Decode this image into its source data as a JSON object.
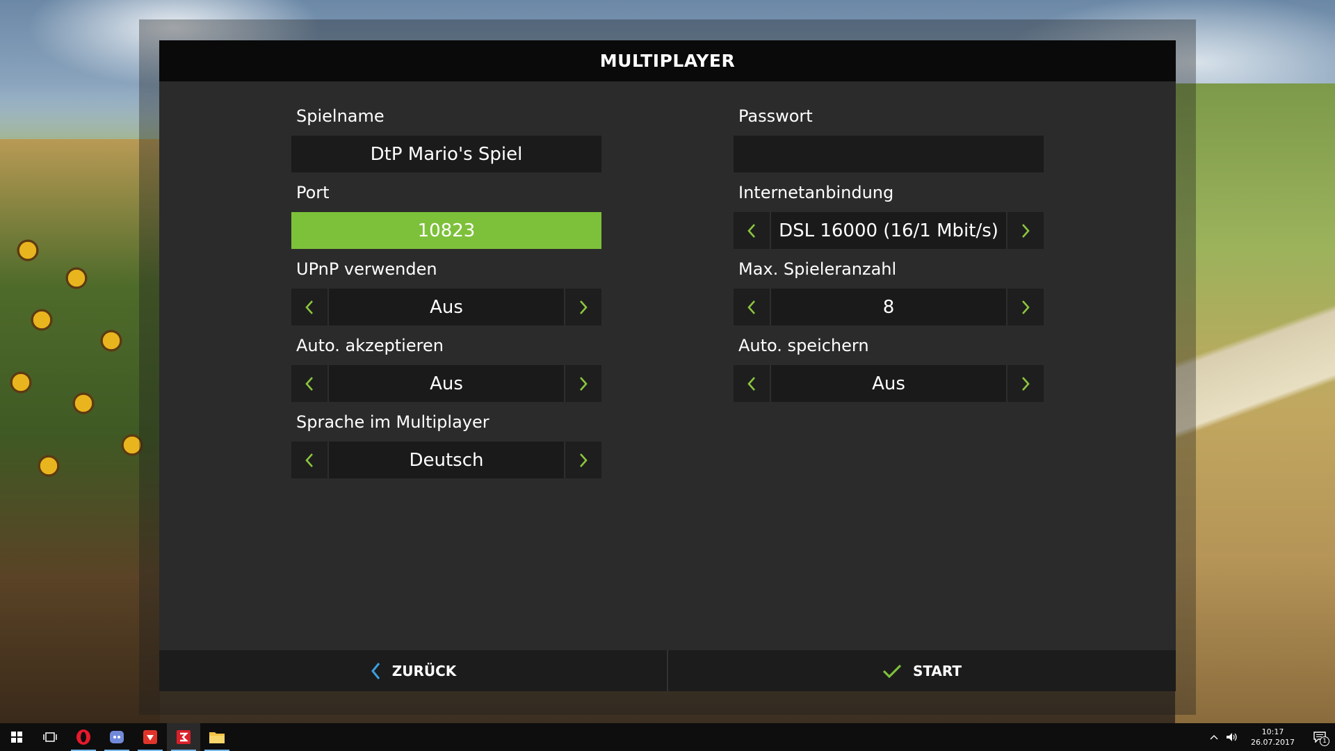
{
  "dialog": {
    "title": "MULTIPLAYER"
  },
  "fields": {
    "game_name": {
      "label": "Spielname",
      "value": "DtP Mario's Spiel"
    },
    "password": {
      "label": "Passwort",
      "value": ""
    },
    "port": {
      "label": "Port",
      "value": "10823"
    },
    "internet": {
      "label": "Internetanbindung",
      "value": "DSL 16000 (16/1 Mbit/s)"
    },
    "upnp": {
      "label": "UPnP verwenden",
      "value": "Aus"
    },
    "max_players": {
      "label": "Max. Spieleranzahl",
      "value": "8"
    },
    "auto_accept": {
      "label": "Auto. akzeptieren",
      "value": "Aus"
    },
    "auto_save": {
      "label": "Auto. speichern",
      "value": "Aus"
    },
    "language": {
      "label": "Sprache im Multiplayer",
      "value": "Deutsch"
    }
  },
  "footer": {
    "back_label": "ZURÜCK",
    "start_label": "START"
  },
  "taskbar": {
    "time": "10:17",
    "date": "26.07.2017",
    "notification_count": "1"
  },
  "colors": {
    "accent_green": "#7dc13a",
    "arrow_green": "#8cc63f",
    "back_blue": "#3aa0e0"
  }
}
